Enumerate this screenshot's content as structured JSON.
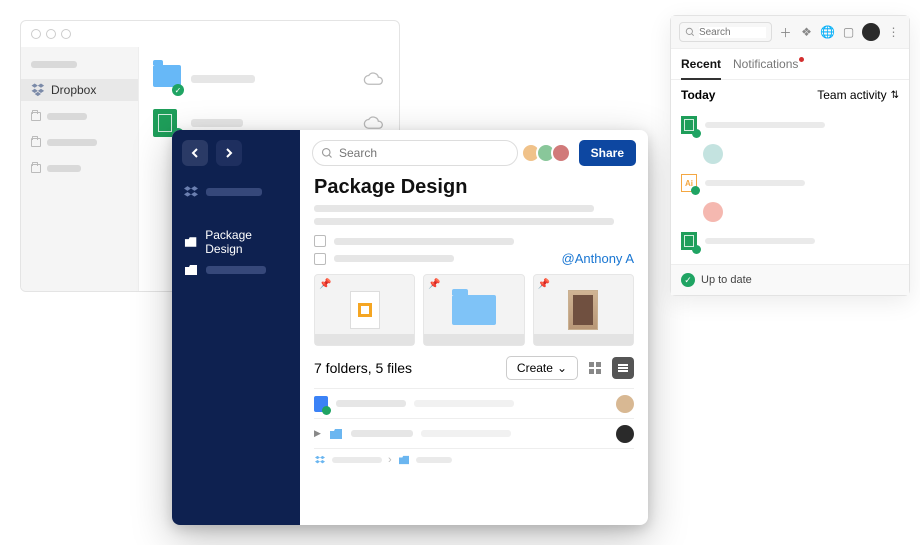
{
  "back_window": {
    "sidebar": {
      "active_label": "Dropbox"
    }
  },
  "main_card": {
    "search_placeholder": "Search",
    "share_label": "Share",
    "title": "Package Design",
    "sidebar": {
      "selected_folder": "Package Design"
    },
    "mention": "@Anthony A",
    "counts": "7 folders, 5 files",
    "create_label": "Create"
  },
  "right_panel": {
    "search_placeholder": "Search",
    "tabs": [
      {
        "label": "Recent",
        "active": true
      },
      {
        "label": "Notifications",
        "active": false,
        "badge": true
      }
    ],
    "today_label": "Today",
    "team_activity_label": "Team activity",
    "footer_status": "Up to date"
  }
}
